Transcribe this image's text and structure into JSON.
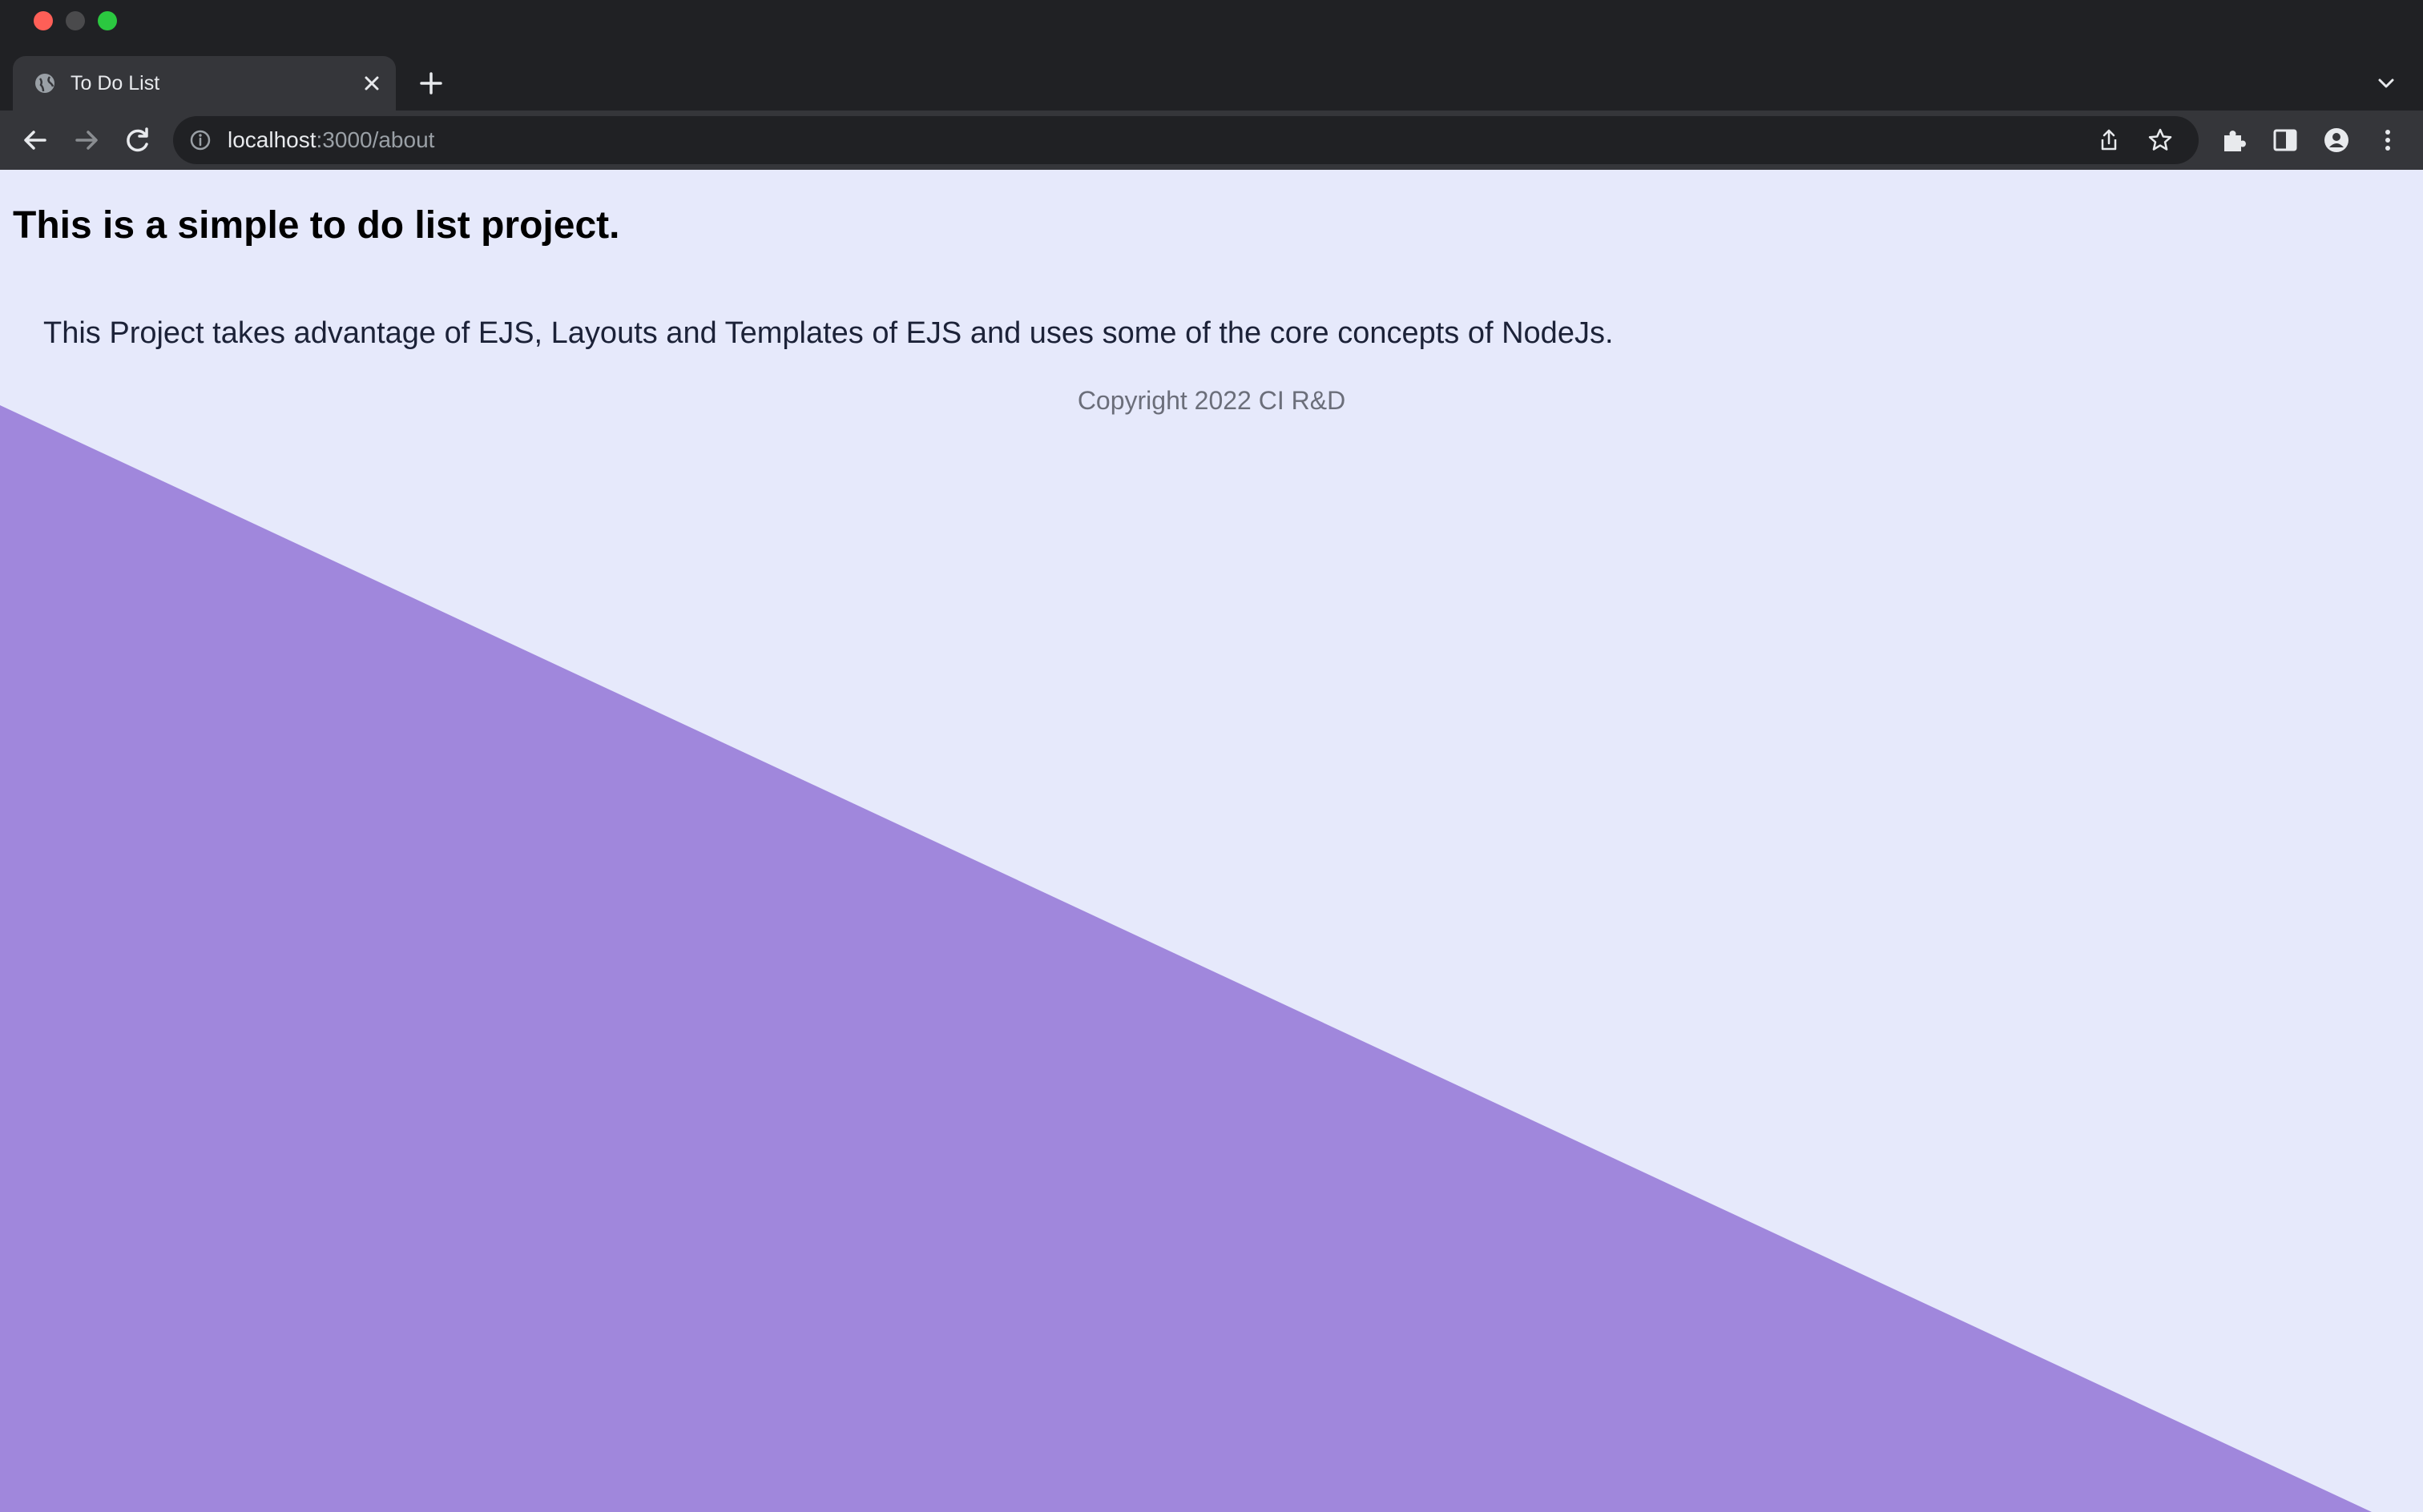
{
  "browser": {
    "tab": {
      "title": "To Do List",
      "favicon": "globe-icon"
    },
    "address_bar": {
      "host": "localhost",
      "path": ":3000/about",
      "info_icon": "info-icon"
    },
    "toolbar_icons": [
      "back-icon",
      "forward-icon",
      "reload-icon",
      "share-icon",
      "bookmark-star-icon",
      "extensions-icon",
      "side-panel-icon",
      "profile-icon",
      "menu-icon"
    ],
    "colors": {
      "frame": "#202124",
      "toolbar": "#35363a",
      "text": "#e8eaed",
      "muted": "#9aa0a6"
    }
  },
  "page": {
    "heading": "This is a simple to do list project.",
    "paragraph": "This Project takes advantage of EJS, Layouts and Templates of EJS and uses some of the core concepts of NodeJs.",
    "footer": "Copyright 2022 CI R&D",
    "colors": {
      "background": "#e6e9fb",
      "accent_shape": "#a087dc",
      "heading": "#000000",
      "footer": "#6b6e7a"
    }
  }
}
